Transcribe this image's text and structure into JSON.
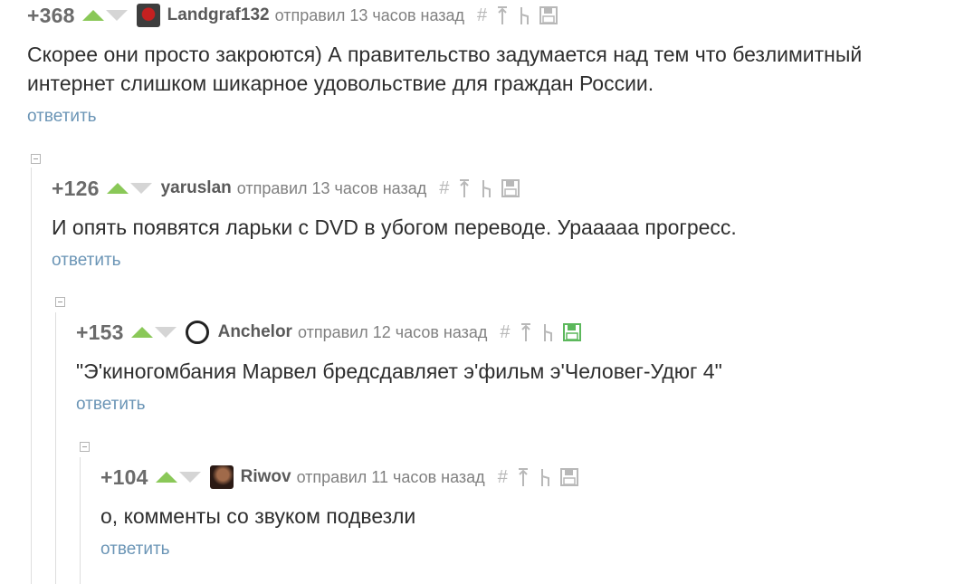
{
  "comments": [
    {
      "rating": "+368",
      "username": "Landgraf132",
      "posted": "отправил 13 часов назад",
      "text": "Скорее они просто закроются) А правительство задумается над тем что безлимитный интернет слишком шикарное удовольствие для граждан России.",
      "reply": "ответить",
      "avatar": "avatar-landgraf132",
      "saved": false
    },
    {
      "rating": "+126",
      "username": "yaruslan",
      "posted": "отправил 13 часов назад",
      "text": "И опять появятся ларьки с DVD в убогом переводе. Урааааа прогресс.",
      "reply": "ответить",
      "avatar": null,
      "saved": false
    },
    {
      "rating": "+153",
      "username": "Anchelor",
      "posted": "отправил 12 часов назад",
      "text": "\"Э'киногомбания Марвел бредсдавляет э'фильм э'Человег-Удюг 4\"",
      "reply": "ответить",
      "avatar": "avatar-anchelor",
      "saved": true
    },
    {
      "rating": "+104",
      "username": "Riwov",
      "posted": "отправил 11 часов назад",
      "text": "о, комменты со звуком подвезли",
      "reply": "ответить",
      "avatar": "avatar-riwov",
      "saved": false
    }
  ],
  "icons": {
    "hash": "#",
    "vote_up": "triangle-up",
    "vote_down": "triangle-down",
    "to_parent": "arrow-up-icon",
    "branch": "branch-icon",
    "save": "floppy-icon"
  },
  "colors": {
    "vote_up": "#8ac858",
    "vote_down": "#d5d5d5",
    "reply_link": "#6b95b6",
    "saved": "#5cb85c"
  }
}
